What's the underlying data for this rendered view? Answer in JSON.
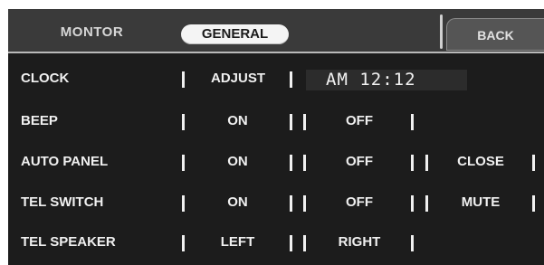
{
  "header": {
    "tab_monitor": "MONTOR",
    "tab_general": "GENERAL",
    "back": "BACK"
  },
  "rows": {
    "clock": {
      "label": "CLOCK",
      "adjust": "ADJUST",
      "time": "AM 12:12"
    },
    "beep": {
      "label": "BEEP",
      "on": "ON",
      "off": "OFF"
    },
    "auto_panel": {
      "label": "AUTO PANEL",
      "on": "ON",
      "off": "OFF",
      "close": "CLOSE"
    },
    "tel_switch": {
      "label": "TEL SWITCH",
      "on": "ON",
      "off": "OFF",
      "mute": "MUTE"
    },
    "tel_speaker": {
      "label": "TEL SPEAKER",
      "left": "LEFT",
      "right": "RIGHT"
    }
  }
}
